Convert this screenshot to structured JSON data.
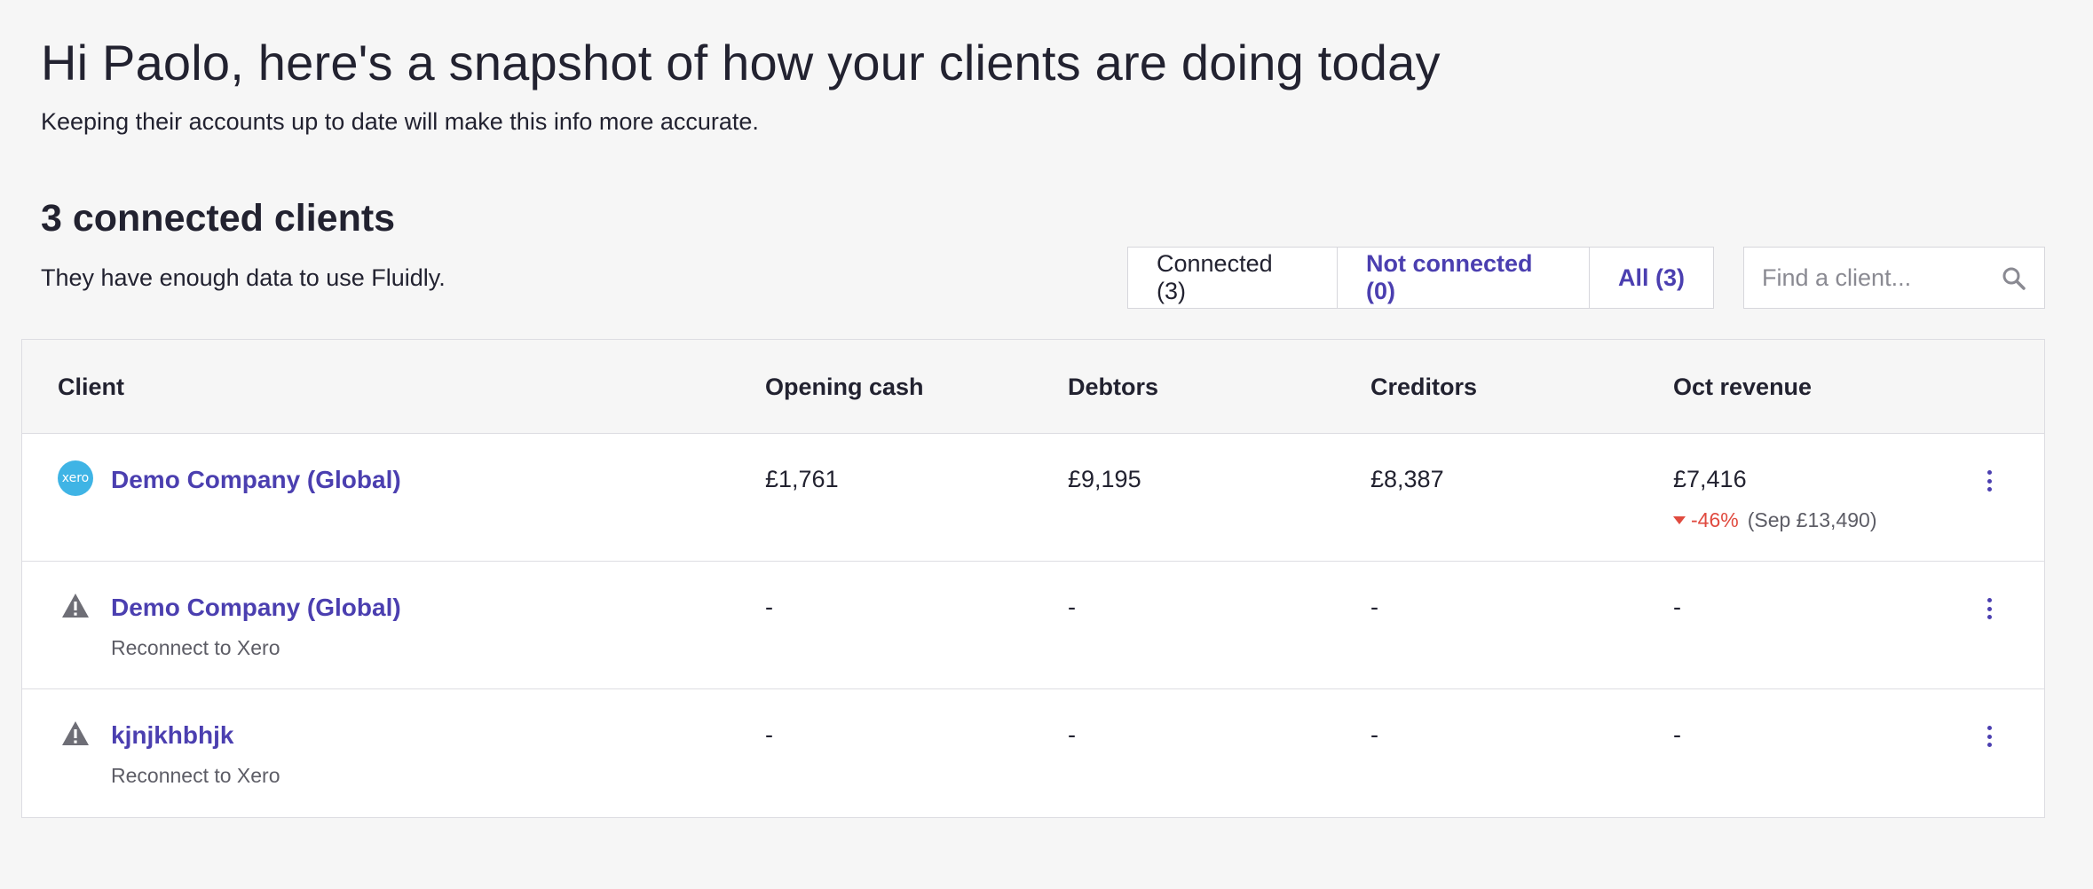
{
  "header": {
    "greeting": "Hi Paolo, here's a snapshot of how your clients are doing today",
    "subtitle": "Keeping their accounts up to date will make this info more accurate."
  },
  "section": {
    "title": "3 connected clients",
    "subtitle": "They have enough data to use Fluidly."
  },
  "filters": {
    "connected": "Connected (3)",
    "not_connected": "Not connected (0)",
    "all": "All (3)"
  },
  "search": {
    "placeholder": "Find a client...",
    "value": ""
  },
  "colors": {
    "accent": "#4b3fb0",
    "negative": "#e04a3f",
    "xero": "#3fb4e5"
  },
  "table": {
    "columns": {
      "client": "Client",
      "opening_cash": "Opening cash",
      "debtors": "Debtors",
      "creditors": "Creditors",
      "revenue": "Oct revenue"
    },
    "rows": [
      {
        "icon": "xero-logo-icon",
        "icon_text": "xero",
        "name": "Demo Company (Global)",
        "opening_cash": "£1,761",
        "debtors": "£9,195",
        "creditors": "£8,387",
        "revenue": "£7,416",
        "change": "-46%",
        "previous": "(Sep £13,490)"
      },
      {
        "icon": "warning-icon",
        "name": "Demo Company (Global)",
        "sub": "Reconnect to Xero",
        "opening_cash": "-",
        "debtors": "-",
        "creditors": "-",
        "revenue": "-"
      },
      {
        "icon": "warning-icon",
        "name": "kjnjkhbhjk",
        "sub": "Reconnect to Xero",
        "opening_cash": "-",
        "debtors": "-",
        "creditors": "-",
        "revenue": "-"
      }
    ]
  }
}
